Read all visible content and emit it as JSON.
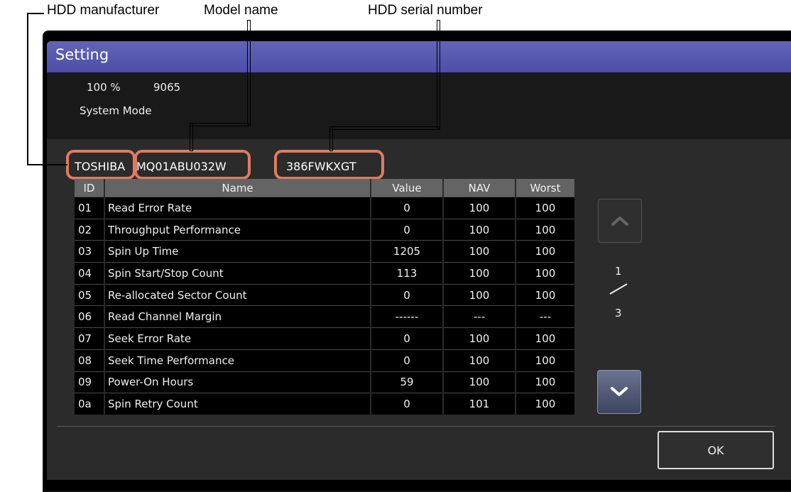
{
  "callouts": {
    "manufacturer": "HDD manufacturer",
    "model": "Model name",
    "serial": "HDD serial number"
  },
  "window": {
    "title": "Setting"
  },
  "status": {
    "percent": "100 %",
    "counter": "9065",
    "mode": "System Mode"
  },
  "hdd": {
    "manufacturer": "TOSHIBA",
    "model": "MQ01ABU032W",
    "serial": "386FWKXGT"
  },
  "table": {
    "headers": [
      "ID",
      "Name",
      "Value",
      "NAV",
      "Worst"
    ],
    "rows": [
      [
        "01",
        "Read Error Rate",
        "0",
        "100",
        "100"
      ],
      [
        "02",
        "Throughput Performance",
        "0",
        "100",
        "100"
      ],
      [
        "03",
        "Spin Up Time",
        "1205",
        "100",
        "100"
      ],
      [
        "04",
        "Spin Start/Stop Count",
        "113",
        "100",
        "100"
      ],
      [
        "05",
        "Re-allocated Sector Count",
        "0",
        "100",
        "100"
      ],
      [
        "06",
        "Read Channel Margin",
        "------",
        "---",
        "---"
      ],
      [
        "07",
        "Seek Error Rate",
        "0",
        "100",
        "100"
      ],
      [
        "08",
        "Seek Time Performance",
        "0",
        "100",
        "100"
      ],
      [
        "09",
        "Power-On Hours",
        "59",
        "100",
        "100"
      ],
      [
        "0a",
        "Spin Retry Count",
        "0",
        "101",
        "100"
      ]
    ]
  },
  "pager": {
    "current": "1",
    "total": "3",
    "up_icon": "chevron-up-icon",
    "down_icon": "chevron-down-icon"
  },
  "buttons": {
    "ok": "OK"
  },
  "colors": {
    "title_bar": "#5558b0",
    "highlight": "#e07b5e",
    "table_header": "#646464"
  }
}
